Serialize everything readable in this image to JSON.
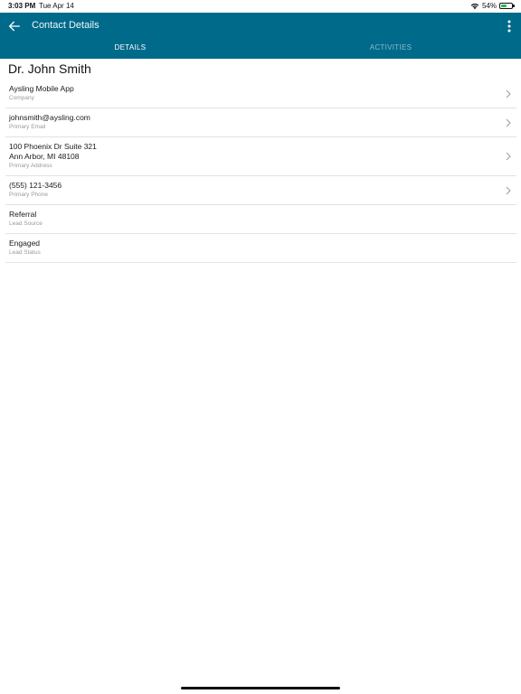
{
  "status_bar": {
    "time": "3:03 PM",
    "date": "Tue Apr 14",
    "battery": "54%"
  },
  "app_bar": {
    "title": "Contact Details",
    "tabs": [
      {
        "label": "DETAILS",
        "active": true
      },
      {
        "label": "ACTIVITIES",
        "active": false
      }
    ]
  },
  "contact": {
    "name": "Dr. John Smith",
    "fields": [
      {
        "lines": [
          "Aysling Mobile App"
        ],
        "label": "Company",
        "navigable": true
      },
      {
        "lines": [
          "johnsmith@aysling.com"
        ],
        "label": "Primary Email",
        "navigable": true
      },
      {
        "lines": [
          "100 Phoenix Dr Suite 321",
          "Ann Arbor, MI 48108"
        ],
        "label": "Primary Address",
        "navigable": true
      },
      {
        "lines": [
          "(555) 121-3456"
        ],
        "label": "Primary Phone",
        "navigable": true
      },
      {
        "lines": [
          "Referral"
        ],
        "label": "Lead Source",
        "navigable": false
      },
      {
        "lines": [
          "Engaged"
        ],
        "label": "Lead Status",
        "navigable": false
      }
    ]
  },
  "colors": {
    "app_bar": "#006a8b",
    "battery_fill": "#2db84d"
  },
  "icons": {
    "back": "arrow-left-icon",
    "menu": "more-vertical-icon",
    "chevron": "chevron-right-icon",
    "wifi": "wifi-icon",
    "battery": "battery-icon"
  }
}
